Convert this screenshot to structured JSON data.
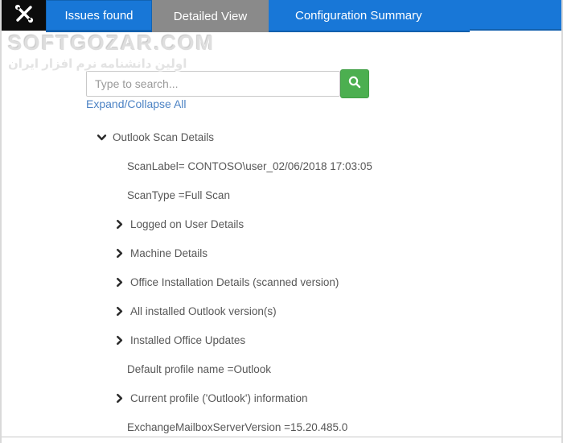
{
  "tabs": [
    {
      "label": "Issues found",
      "active": false
    },
    {
      "label": "Detailed View",
      "active": true
    },
    {
      "label": "Configuration Summary",
      "active": false
    }
  ],
  "watermark": {
    "title": "SOFTGOZAR.COM",
    "subtitle": "اولین دانشنامه نرم افزار ایران"
  },
  "search": {
    "placeholder": "Type to search...",
    "button_icon": "search-icon",
    "expand_collapse_label": "Expand/Collapse All"
  },
  "tree": {
    "items": [
      {
        "label": "Outlook Scan Details",
        "chevron": "down",
        "level": 0
      },
      {
        "label": "ScanLabel= CONTOSO\\user_02/06/2018 17:03:05",
        "chevron": "none",
        "level": 1
      },
      {
        "label": "ScanType =Full Scan",
        "chevron": "none",
        "level": 1
      },
      {
        "label": "Logged on User Details",
        "chevron": "right",
        "level": 1
      },
      {
        "label": "Machine Details",
        "chevron": "right",
        "level": 1
      },
      {
        "label": "Office Installation Details (scanned version)",
        "chevron": "right",
        "level": 1
      },
      {
        "label": "All installed Outlook version(s)",
        "chevron": "right",
        "level": 1
      },
      {
        "label": "Installed Office Updates",
        "chevron": "right",
        "level": 1
      },
      {
        "label": "Default profile name =Outlook",
        "chevron": "none",
        "level": 1
      },
      {
        "label": "Current profile ('Outlook') information",
        "chevron": "right",
        "level": 1
      },
      {
        "label": "ExchangeMailboxServerVersion =15.20.485.0",
        "chevron": "none",
        "level": 1
      }
    ]
  },
  "colors": {
    "tab_blue": "#1877d7",
    "tab_blue_border": "#1260ad",
    "tab_gray": "#8a8a8a",
    "app_icon_bg": "#0c0c0c",
    "search_green": "#4caf50",
    "link_blue": "#4d83c4",
    "tree_text": "#575757"
  }
}
